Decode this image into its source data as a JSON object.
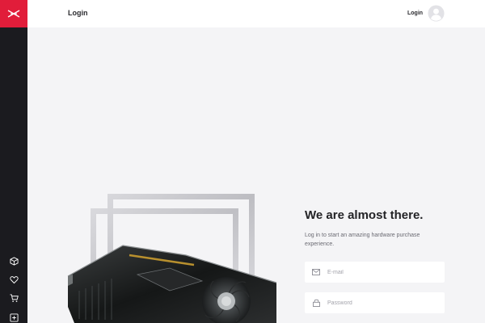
{
  "header": {
    "title": "Login",
    "login_link": "Login"
  },
  "sidebar": {
    "logo": "brand-logo-icon",
    "items": [
      {
        "icon": "cube-icon"
      },
      {
        "icon": "heart-icon"
      },
      {
        "icon": "cart-icon"
      },
      {
        "icon": "add-box-icon"
      }
    ]
  },
  "login": {
    "headline": "We are almost there.",
    "subtext": "Log in to start an amazing hardware purchase experience.",
    "email_placeholder": "E-mail",
    "password_placeholder": "Password"
  },
  "colors": {
    "accent": "#e11d3a",
    "sidebar": "#1b1b1f",
    "background": "#f4f4f6"
  }
}
